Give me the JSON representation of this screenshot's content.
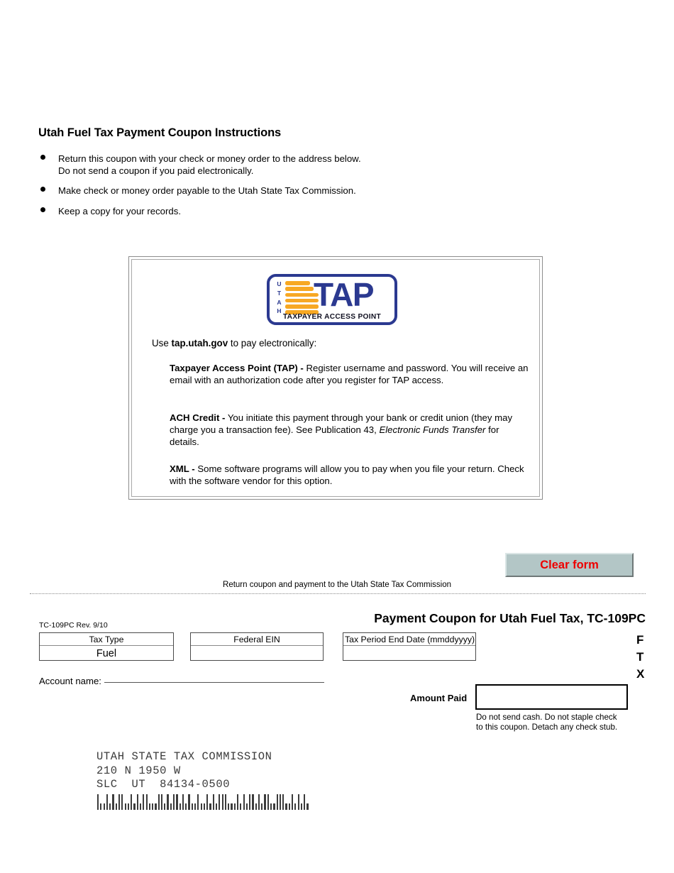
{
  "document": {
    "title": "Utah Fuel Tax Payment Coupon Instructions",
    "bullets": [
      {
        "line1": "Return this coupon with your check or money order to the address below.",
        "line2": "Do not send a coupon if you paid electronically."
      },
      {
        "line1": "Make check or money order payable to the Utah State Tax Commission.",
        "line2": ""
      },
      {
        "line1": "Keep a copy for your records.",
        "line2": ""
      }
    ]
  },
  "tap_panel": {
    "logo": {
      "utah_letters": [
        "U",
        "T",
        "A",
        "H"
      ],
      "wordmark": "TAP",
      "subtitle": "TAXPAYER ACCESS POINT",
      "border_color": "#2b3990",
      "bar_color": "#f7a823",
      "text_color": "#2b3990"
    },
    "use_line": {
      "before": "Use ",
      "bold": "tap.utah.gov",
      "after": " to pay electronically:"
    },
    "items": [
      {
        "heading": "Taxpayer Access Point (TAP) -",
        "body": " Register username and password. You will receive an email with an authorization code after you register for TAP access.",
        "italic": "",
        "body_tail": ""
      },
      {
        "heading": "ACH Credit -",
        "body": " You initiate this payment through your bank or credit union (they may charge you a transaction fee). See Publication 43, ",
        "italic": "Electronic Funds Transfer",
        "body_tail": " for details."
      },
      {
        "heading": "XML -",
        "body": " Some software programs will allow you to pay when you file your return. Check with the software vendor for this option.",
        "italic": "",
        "body_tail": ""
      }
    ]
  },
  "toolbar": {
    "clear_form_label": "Clear form",
    "clear_form_text_color": "#ee0000",
    "clear_form_bg_color": "#b3c6c6"
  },
  "coupon": {
    "return_note": "Return coupon and payment to the Utah State Tax Commission",
    "title": "Payment Coupon for Utah Fuel Tax, TC-109PC",
    "revision": "TC-109PC Rev. 9/10",
    "ftx_letters": [
      "F",
      "T",
      "X"
    ],
    "fields": [
      {
        "label": "Tax Type",
        "value": "Fuel",
        "placeholder": ""
      },
      {
        "label": "Federal EIN",
        "value": "",
        "placeholder": ""
      },
      {
        "label": "Tax Period End Date (mmddyyyy)",
        "value": "",
        "placeholder": ""
      }
    ],
    "account_name_label": "Account name:",
    "account_name_value": "",
    "amount_label": "Amount Paid",
    "amount_value": "",
    "amount_note_line1": "Do not send cash. Do not staple check",
    "amount_note_line2": "to this coupon. Detach any check stub.",
    "mailing_address": "UTAH STATE TAX COMMISSION\n210 N 1950 W\nSLC  UT  84134-0500",
    "barcode_pattern": "tsstststtsstststtsssttststtststsstsstststttssstststtststtsstttsstststs"
  }
}
